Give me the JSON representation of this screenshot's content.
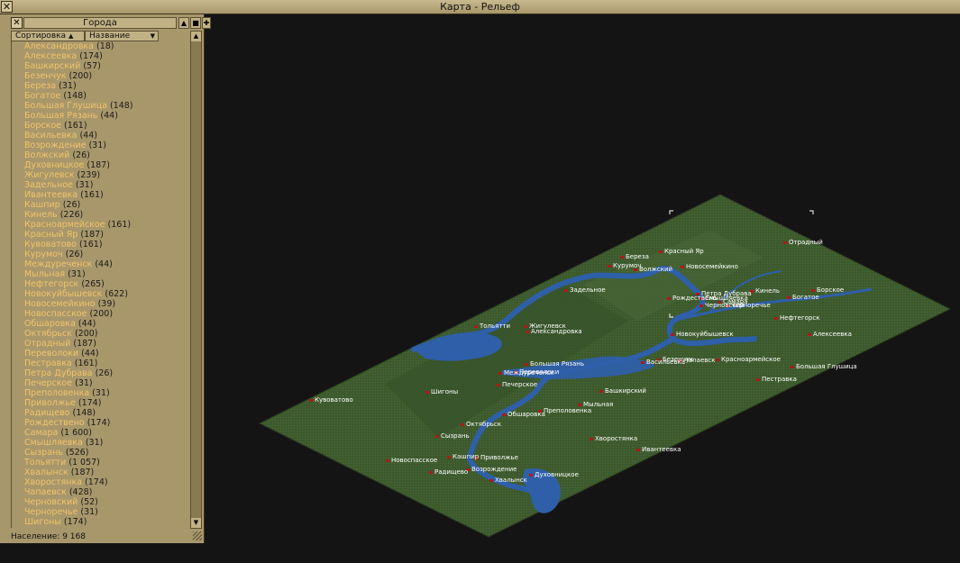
{
  "window": {
    "title": "Карта - Рельеф",
    "close_glyph": "✕"
  },
  "panel": {
    "title": "Города",
    "close_glyph": "✕",
    "btn_collapse": "▲",
    "btn_restore": "■",
    "btn_pin": "✚",
    "sort": {
      "label": "Сортировка",
      "arrow": "▲",
      "value": "Название",
      "dropdown": "▼"
    },
    "scroll_up": "▲",
    "scroll_down": "▼",
    "status": "Население: 9 168"
  },
  "cities": [
    {
      "name": "Александровка",
      "pop": "(18)"
    },
    {
      "name": "Алексеевка",
      "pop": "(174)"
    },
    {
      "name": "Башкирский",
      "pop": "(57)"
    },
    {
      "name": "Безенчук",
      "pop": "(200)"
    },
    {
      "name": "Береза",
      "pop": "(31)"
    },
    {
      "name": "Богатое",
      "pop": "(148)"
    },
    {
      "name": "Большая Глушица",
      "pop": "(148)"
    },
    {
      "name": "Большая Рязань",
      "pop": "(44)"
    },
    {
      "name": "Борское",
      "pop": "(161)"
    },
    {
      "name": "Васильевка",
      "pop": "(44)"
    },
    {
      "name": "Возрождение",
      "pop": "(31)"
    },
    {
      "name": "Волжский",
      "pop": "(26)"
    },
    {
      "name": "Духовницкое",
      "pop": "(187)"
    },
    {
      "name": "Жигулевск",
      "pop": "(239)"
    },
    {
      "name": "Задельное",
      "pop": "(31)"
    },
    {
      "name": "Ивантеевка",
      "pop": "(161)"
    },
    {
      "name": "Кашпир",
      "pop": "(26)"
    },
    {
      "name": "Кинель",
      "pop": "(226)"
    },
    {
      "name": "Красноармейское",
      "pop": "(161)"
    },
    {
      "name": "Красный Яр",
      "pop": "(187)"
    },
    {
      "name": "Кувоватово",
      "pop": "(161)"
    },
    {
      "name": "Курумоч",
      "pop": "(26)"
    },
    {
      "name": "Междуреченск",
      "pop": "(44)"
    },
    {
      "name": "Мыльная",
      "pop": "(31)"
    },
    {
      "name": "Нефтегорск",
      "pop": "(265)"
    },
    {
      "name": "Новокуйбышевск",
      "pop": "(622)"
    },
    {
      "name": "Новосемейкино",
      "pop": "(39)"
    },
    {
      "name": "Новоспасское",
      "pop": "(200)"
    },
    {
      "name": "Обшаровка",
      "pop": "(44)"
    },
    {
      "name": "Октябрьск",
      "pop": "(200)"
    },
    {
      "name": "Отрадный",
      "pop": "(187)"
    },
    {
      "name": "Переволоки",
      "pop": "(44)"
    },
    {
      "name": "Пестравка",
      "pop": "(161)"
    },
    {
      "name": "Петра Дубрава",
      "pop": "(26)"
    },
    {
      "name": "Печерское",
      "pop": "(31)"
    },
    {
      "name": "Преполовенка",
      "pop": "(31)"
    },
    {
      "name": "Приволжье",
      "pop": "(174)"
    },
    {
      "name": "Радищево",
      "pop": "(148)"
    },
    {
      "name": "Рождествено",
      "pop": "(174)"
    },
    {
      "name": "Самара",
      "pop": "(1 600)"
    },
    {
      "name": "Смышляевка",
      "pop": "(31)"
    },
    {
      "name": "Сызрань",
      "pop": "(526)"
    },
    {
      "name": "Тольятти",
      "pop": "(1 057)"
    },
    {
      "name": "Хвалынск",
      "pop": "(187)"
    },
    {
      "name": "Хворостянка",
      "pop": "(174)"
    },
    {
      "name": "Чапаевск",
      "pop": "(428)"
    },
    {
      "name": "Черновский",
      "pop": "(52)"
    },
    {
      "name": "Черноречье",
      "pop": "(31)"
    },
    {
      "name": "Шигоны",
      "pop": "(174)"
    }
  ],
  "map_labels": [
    "Отрадный",
    "Береза",
    "Красный Яр",
    "Курумоч",
    "Волжский",
    "Новосемейкино",
    "Задельное",
    "Петра Дубрава",
    "Кинель",
    "Борское",
    "Рождествено",
    "Смышляевка",
    "Богатое",
    "Самара",
    "Черновский",
    "Черноречье",
    "Нефтегорск",
    "Тольятти",
    "Жигулевск",
    "Александровка",
    "Новокуйбышевск",
    "Алексеевка",
    "Безенчук",
    "Васильевка",
    "Чапаевск",
    "Красноармейское",
    "Большая Глушица",
    "Большая Рязань",
    "Переволоки",
    "Междуреченск",
    "Пестравка",
    "Печерское",
    "Кувоватово",
    "Шигоны",
    "Башкирский",
    "Мыльная",
    "Преполовенка",
    "Обшаровка",
    "Октябрьск",
    "Сызрань",
    "Хворостянка",
    "Ивантеевка",
    "Новоспасское",
    "Кашпир",
    "Приволжье",
    "Возрождение",
    "Радищево",
    "Хвалынск",
    "Духовницкое"
  ],
  "colors": {
    "panel": "#a8976b",
    "city_name": "#f2c468",
    "terrain": "#3d5a2e",
    "water": "#2e5fa8",
    "city_marker": "#b01818"
  }
}
